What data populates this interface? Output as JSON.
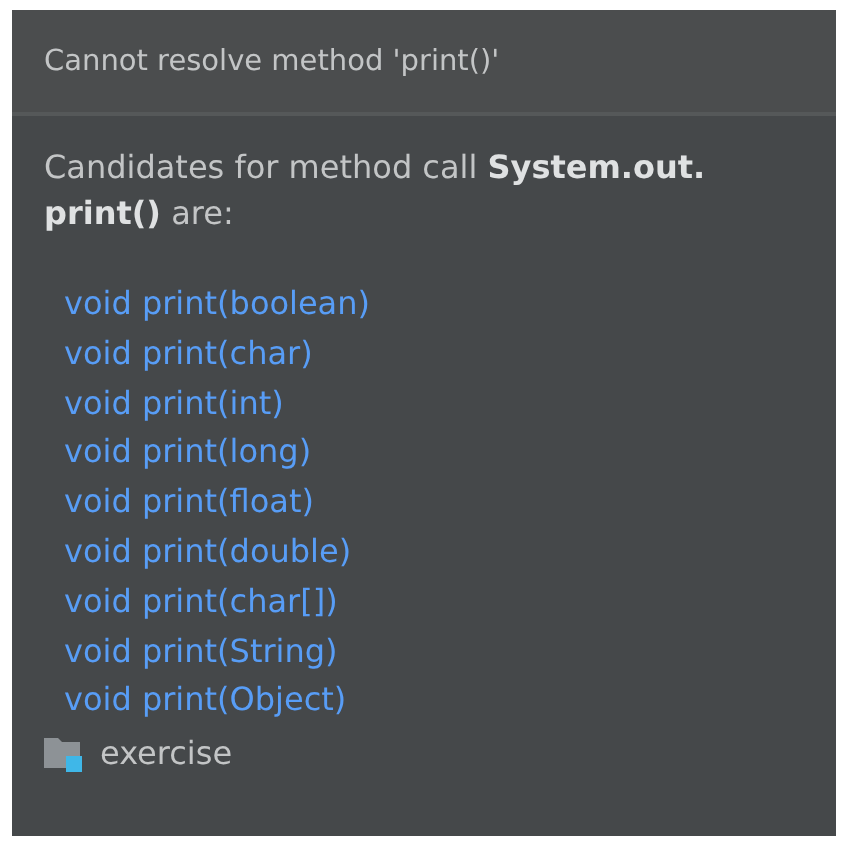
{
  "header": {
    "title": "Cannot resolve method 'print()'"
  },
  "description": "Candidates for method call **System.out. print()** are:",
  "candidates": [
    "void print(boolean)",
    "void print(char)",
    "void print(int)",
    "void print(long)",
    "void print(float)",
    "void print(double)",
    "void print(char[])",
    "void print(String)",
    "void print(Object)"
  ],
  "footer": {
    "module": "exercise"
  }
}
